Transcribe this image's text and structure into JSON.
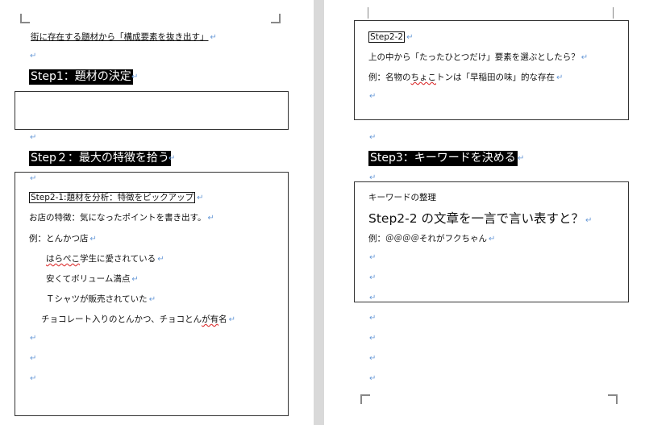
{
  "left_page": {
    "intro": "街に存在する題材から「構成要素を抜き出す」",
    "step1_heading": "Step1：題材の決定",
    "step2_heading": "Step２：最大の特徴を拾う",
    "step2_1_title": "Step2-1:題材を分析：特徴をピックアップ",
    "features_line": "お店の特徴：気になったポイントを書き出す。",
    "example_line": "例：とんかつ店",
    "item1_pre": "はらぺこ",
    "item1_post": "学生に愛されている",
    "item2": "安くてボリューム満点",
    "item3": "Ｔシャツが販売されていた",
    "item4_pre": "チョコレート入りのとんかつ、チョコとん",
    "item4_wavy": "が有",
    "item4_post": "名"
  },
  "right_page": {
    "step2_2_label": "Step2-2",
    "question": "上の中から「たったひとつだけ」要素を選ぶとしたら？",
    "example_pre": "例：名物の",
    "example_wavy": "ちょこ",
    "example_post": "トンは「早稲田の味」的な存在",
    "step3_heading": "Step3：キーワードを決める",
    "keyword_title": "キーワードの整理",
    "keyword_prompt": "Step2-2 の文章を一言で言い表すと？",
    "keyword_example": "例：＠＠＠＠それがフクちゃん"
  },
  "para_mark": "↵"
}
